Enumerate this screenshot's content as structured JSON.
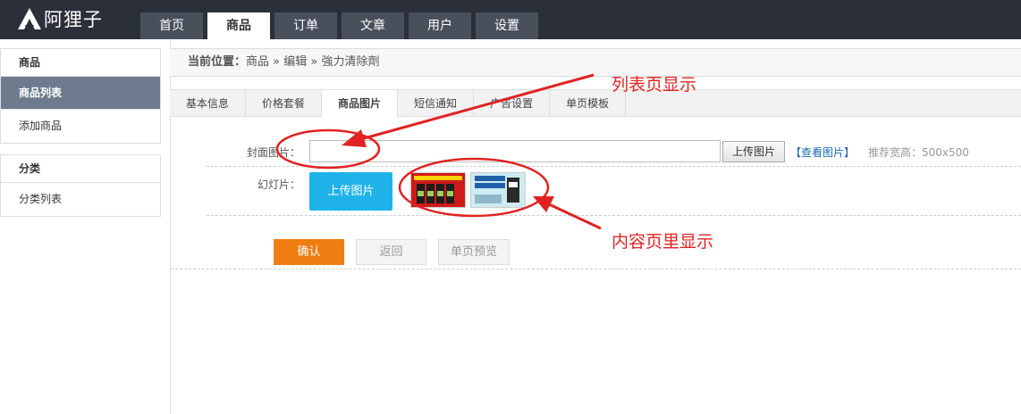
{
  "brand": {
    "name": "阿狸子",
    "logo_icon": "fox-logo-icon"
  },
  "nav": {
    "tabs": [
      {
        "label": "首页"
      },
      {
        "label": "商品"
      },
      {
        "label": "订单"
      },
      {
        "label": "文章"
      },
      {
        "label": "用户"
      },
      {
        "label": "设置"
      }
    ],
    "active": "商品"
  },
  "sidebar": {
    "groups": [
      {
        "title": "商品",
        "items": [
          {
            "label": "商品列表"
          },
          {
            "label": "添加商品"
          }
        ]
      },
      {
        "title": "分类",
        "items": [
          {
            "label": "分类列表"
          }
        ]
      }
    ],
    "active_item": "商品列表"
  },
  "breadcrumb": {
    "prefix": "当前位置：",
    "path": "商品 » 编辑 » 強力清除劑"
  },
  "tabs": [
    {
      "label": "基本信息"
    },
    {
      "label": "价格套餐"
    },
    {
      "label": "商品图片"
    },
    {
      "label": "短信通知"
    },
    {
      "label": "广告设置"
    },
    {
      "label": "单页模板"
    }
  ],
  "active_tab": "商品图片",
  "form": {
    "cover_label": "封面图片：",
    "cover_value": "",
    "upload_small_label": "上传图片",
    "view_link": "【查看图片】",
    "size_hint": "推荐宽高：500x500",
    "slides_label": "幻灯片：",
    "upload_big_label": "上传图片",
    "slides": [
      {
        "name": "slide-thumb-1"
      },
      {
        "name": "slide-thumb-2"
      }
    ]
  },
  "actions": {
    "confirm": "确认",
    "back": "返回",
    "preview": "单页预览"
  },
  "annotations": {
    "list_note": "列表页显示",
    "content_note": "内容页里显示",
    "color": "#e02222"
  },
  "colors": {
    "topbar": "#2b2f3a",
    "sidebar_active": "#6e7b8e",
    "upload_blue": "#1fb3e9",
    "confirm_orange": "#f07d12"
  }
}
